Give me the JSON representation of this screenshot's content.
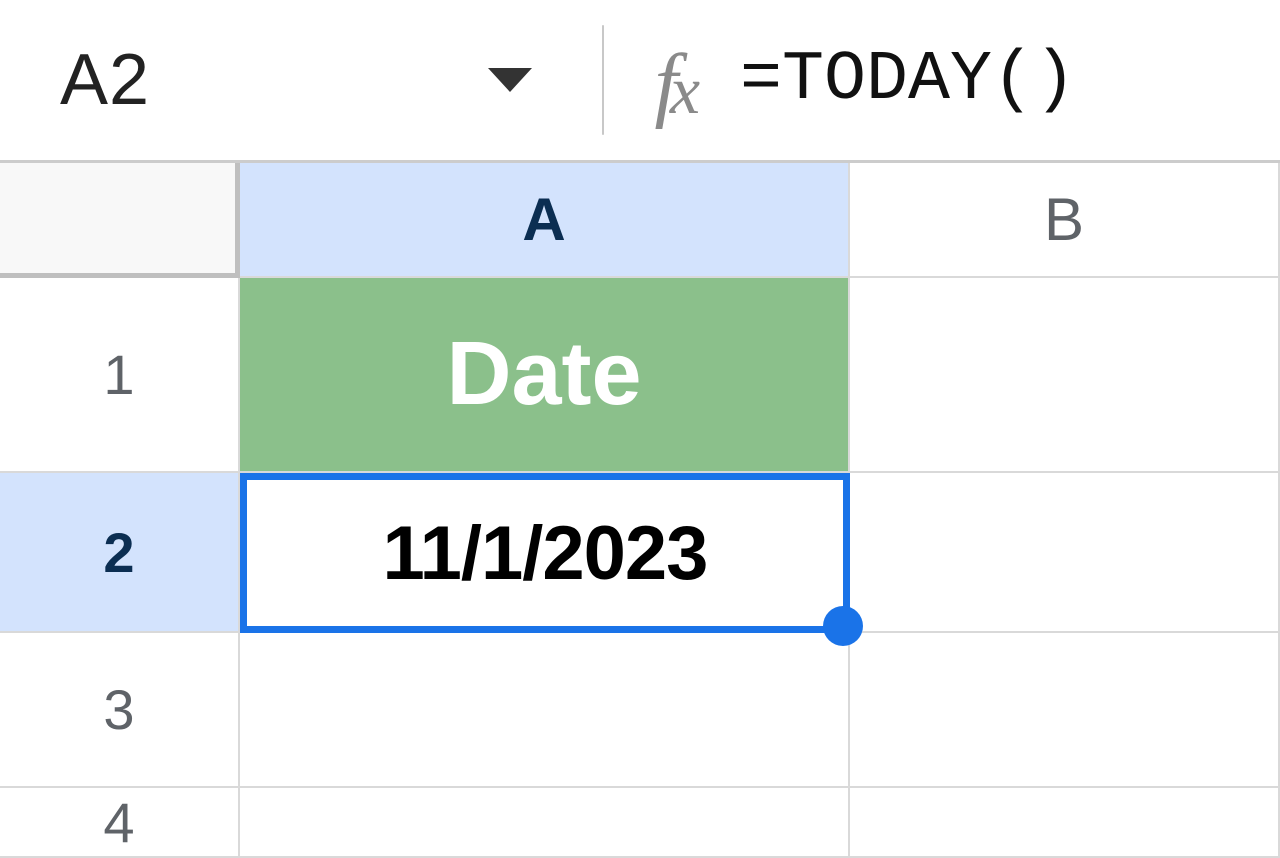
{
  "formula_bar": {
    "cell_reference": "A2",
    "formula": "=TODAY()"
  },
  "columns": [
    "A",
    "B"
  ],
  "rows": [
    "1",
    "2",
    "3",
    "4"
  ],
  "active_column": "A",
  "active_row": "2",
  "cells": {
    "A1": "Date",
    "A2": "11/1/2023",
    "A3": "",
    "A4": "",
    "B1": "",
    "B2": "",
    "B3": "",
    "B4": ""
  },
  "colors": {
    "selection": "#1a73e8",
    "header_green": "#8bc08b",
    "active_header_bg": "#d3e3fd"
  }
}
